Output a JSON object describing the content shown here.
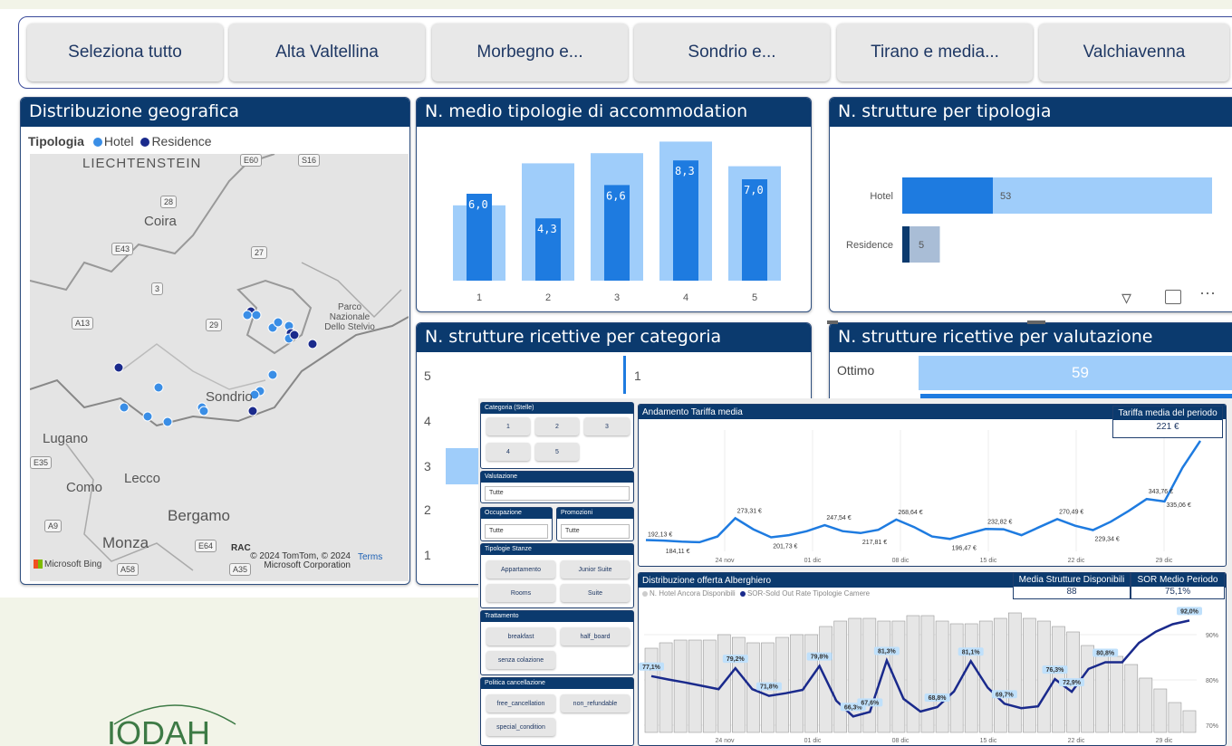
{
  "slicer": {
    "buttons": [
      "Seleziona tutto",
      "Alta Valtellina",
      "Morbegno e...",
      "Sondrio e...",
      "Tirano e media...",
      "Valchiavenna"
    ]
  },
  "geo": {
    "title": "Distribuzione geografica",
    "legend_title": "Tipologia",
    "legend_items": [
      "Hotel",
      "Residence"
    ],
    "colors": {
      "hotel": "#3a8ee6",
      "residence": "#1a2a8c"
    },
    "places": [
      "LIECHTENSTEIN",
      "Coira",
      "Parco Nazionale Dello Stelvio",
      "Sondrio",
      "Lugano",
      "Lecco",
      "Como",
      "Bergamo",
      "Monza"
    ],
    "roads": [
      "E60",
      "S16",
      "28",
      "E43",
      "27",
      "3",
      "A13",
      "29",
      "E35",
      "A9",
      "E64",
      "A58",
      "A35"
    ],
    "copyright": "© 2024 TomTom, © 2024 Microsoft Corporation",
    "terms": "Terms",
    "bing": "Microsoft Bing",
    "rac": "RAC"
  },
  "avg_types": {
    "title": "N. medio tipologie di accommodation",
    "chart_data": {
      "type": "bar",
      "categories": [
        "1",
        "2",
        "3",
        "4",
        "5"
      ],
      "series": [
        {
          "values": [
            5.2,
            8.1,
            8.8,
            9.6,
            7.9
          ]
        },
        {
          "values": [
            6.0,
            4.3,
            6.6,
            8.3,
            7.0
          ]
        }
      ],
      "value_labels": [
        "6,0",
        "4,3",
        "6,6",
        "8,3",
        "7,0"
      ],
      "ylim": [
        0,
        10.5
      ]
    }
  },
  "by_type": {
    "title": "N. strutture per tipologia",
    "chart_data": {
      "type": "bar",
      "categories": [
        "Hotel",
        "Residence"
      ],
      "values": [
        53,
        5
      ],
      "labels": [
        "53",
        "5"
      ]
    }
  },
  "by_category": {
    "title": "N. strutture ricettive per categoria",
    "categories": [
      "5",
      "4",
      "3",
      "2",
      "1"
    ],
    "value_label": "1"
  },
  "by_rating": {
    "title": "N. strutture ricettive per valutazione",
    "first_label": "Ottimo",
    "first_value": "59"
  },
  "filters": {
    "category": {
      "title": "Categoria (Stelle)",
      "options": [
        "1",
        "2",
        "3",
        "4",
        "5"
      ]
    },
    "valutazione": {
      "title": "Valutazione",
      "value": "Tutte"
    },
    "occupazione": {
      "title": "Occupazione",
      "value": "Tutte"
    },
    "promozioni": {
      "title": "Promozioni",
      "value": "Tutte"
    },
    "tipologie": {
      "title": "Tipologie Stanze",
      "options": [
        "Appartamento",
        "Junior Suite",
        "Rooms",
        "Suite"
      ]
    },
    "trattamento": {
      "title": "Trattamento",
      "options": [
        "breakfast",
        "half_board",
        "senza colazione"
      ]
    },
    "cancellazione": {
      "title": "Politica cancellazione",
      "options": [
        "free_cancellation",
        "non_refundable",
        "special_condition"
      ]
    }
  },
  "tariffa": {
    "title": "Andamento Tariffa media",
    "kpi_title": "Tariffa media del periodo",
    "kpi_value": "221 €",
    "chart_data": {
      "type": "line",
      "x_ticks": [
        "24 nov",
        "01 dic",
        "08 dic",
        "15 dic",
        "22 dic",
        "29 dic"
      ],
      "labels": [
        "192,13 €",
        "184,11 €",
        "273,31 €",
        "201,73 €",
        "247,54 €",
        "217,81 €",
        "268,64 €",
        "196,47 €",
        "232,82 €",
        "270,49 €",
        "229,34 €",
        "343,76 €",
        "335,06 €"
      ],
      "values": [
        192,
        190,
        186,
        184,
        205,
        273,
        232,
        202,
        210,
        225,
        247,
        225,
        218,
        230,
        268,
        240,
        205,
        196,
        215,
        233,
        232,
        210,
        240,
        270,
        245,
        229,
        260,
        300,
        344,
        335,
        460,
        560
      ]
    }
  },
  "offerta": {
    "title": "Distribuzione offerta Alberghiero",
    "kpi1_title": "Media Strutture Disponibili",
    "kpi1_value": "88",
    "kpi2_title": "SOR Medio Periodo",
    "kpi2_value": "75,1%",
    "legend": [
      "N. Hotel Ancora Disponibili",
      "SOR-Sold Out Rate Tipologie Camere"
    ],
    "chart_data": {
      "type": "bar",
      "x_ticks": [
        "24 nov",
        "01 dic",
        "08 dic",
        "15 dic",
        "22 dic",
        "29 dic"
      ],
      "y_ticks": [
        "90%",
        "80%",
        "70%"
      ],
      "bars": [
        62,
        66,
        68,
        68,
        68,
        72,
        70,
        66,
        66,
        70,
        72,
        72,
        78,
        82,
        84,
        84,
        82,
        82,
        86,
        86,
        82,
        80,
        80,
        82,
        84,
        88,
        84,
        82,
        78,
        74,
        64,
        60,
        56,
        50,
        40,
        32,
        22,
        16
      ],
      "line": [
        77.1,
        76.2,
        75.4,
        74.5,
        73.6,
        79.2,
        73.6,
        71.8,
        72.5,
        73.4,
        79.8,
        70.5,
        66.3,
        67.5,
        81.3,
        71.0,
        67.6,
        68.8,
        73.0,
        81.1,
        74.0,
        69.7,
        68.5,
        69.0,
        76.3,
        72.9,
        79.0,
        80.8,
        80.8,
        86.0,
        89.0,
        91.0,
        92.0
      ],
      "labels": [
        "77,1%",
        "79,2%",
        "71,8%",
        "79,8%",
        "66,3%",
        "67,6%",
        "81,3%",
        "68,8%",
        "81,1%",
        "69,7%",
        "76,3%",
        "72,9%",
        "80,8%",
        "92,0%"
      ]
    }
  },
  "logo_text": "IODAH"
}
